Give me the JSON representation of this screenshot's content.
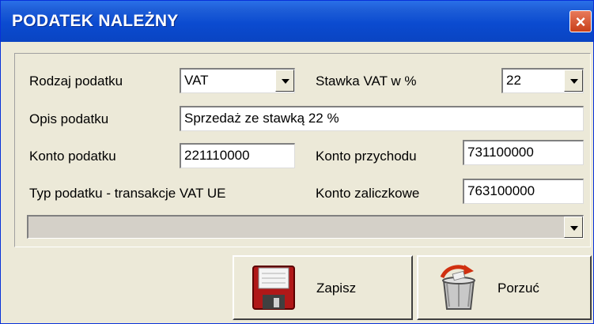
{
  "window": {
    "title": "PODATEK NALEŻNY",
    "close_label": "×"
  },
  "form": {
    "rodzaj_label": "Rodzaj podatku",
    "rodzaj_value": "VAT",
    "stawka_label": "Stawka VAT w  %",
    "stawka_value": "22",
    "opis_label": "Opis podatku",
    "opis_value": "Sprzedaż ze stawką 22 %",
    "konto_podatku_label": "Konto podatku",
    "konto_podatku_value": "221110000",
    "konto_przychodu_label": "Konto przychodu",
    "konto_przychodu_value": "731100000",
    "typ_label": "Typ podatku - transakcje  VAT UE",
    "konto_zaliczkowe_label": "Konto zaliczkowe",
    "konto_zaliczkowe_value": "763100000"
  },
  "buttons": {
    "save_label": "Zapisz",
    "discard_label": "Porzuć"
  },
  "icons": {
    "save": "floppy-disk-icon",
    "discard": "trash-bin-icon"
  },
  "colors": {
    "title_bar": "#0b4bd0",
    "close_button": "#d9542c",
    "window_bg": "#ece9d8"
  }
}
